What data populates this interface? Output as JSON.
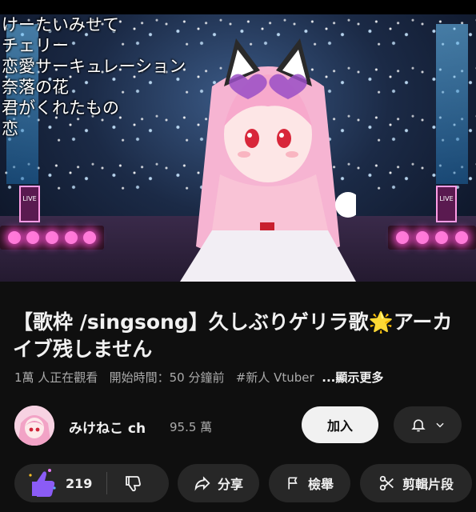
{
  "video": {
    "setlist": [
      "けーたいみせて",
      "チェリー",
      "恋愛サーキュレーション",
      "奈落の花",
      "君がくれたもの",
      "恋"
    ],
    "stage_sign": "LIVE"
  },
  "title": "【歌枠 /singsong】久しぶりゲリラ歌🌟アーカイブ残しません",
  "meta": {
    "viewers": "1萬 人正在觀看",
    "started": "開始時間：50 分鐘前",
    "tag": "#新人 Vtuber",
    "more": "...顯示更多"
  },
  "channel": {
    "name": "みけねこ ch",
    "subscribers": "95.5 萬",
    "join_label": "加入",
    "bell_icon": "bell-icon",
    "chevron_icon": "chevron-down-icon"
  },
  "actions": {
    "like_count": "219",
    "like_icon": "like-icon",
    "dislike_icon": "dislike-icon",
    "share_label": "分享",
    "report_label": "檢舉",
    "clip_label": "剪輯片段"
  },
  "colors": {
    "background": "#0f0f0f",
    "pill": "#272727",
    "text": "#f1f1f1",
    "secondary_text": "#aaaaaa",
    "like_accent": "#8b5cf6"
  }
}
